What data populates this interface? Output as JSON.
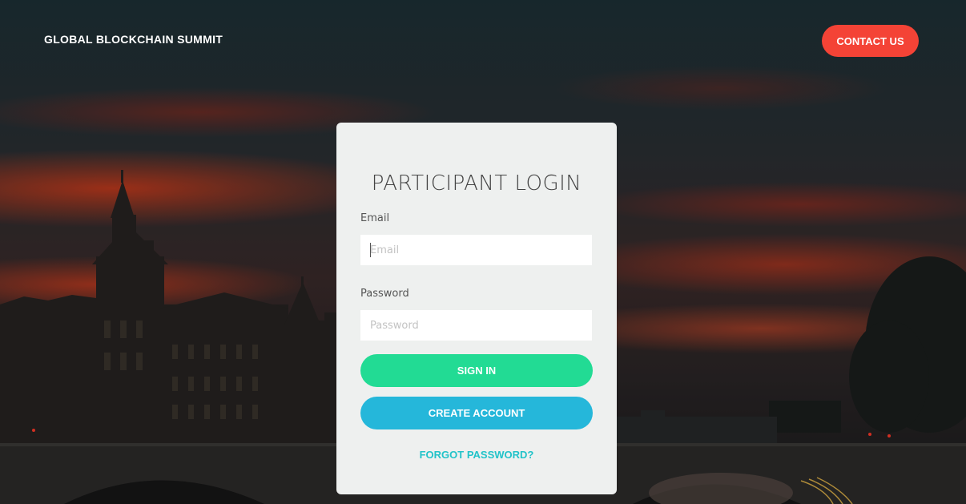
{
  "header": {
    "brand": "GLOBAL BLOCKCHAIN SUMMIT",
    "contact_label": "CONTACT US"
  },
  "login": {
    "title": "PARTICIPANT LOGIN",
    "email_label": "Email",
    "email_placeholder": "Email",
    "email_value": "",
    "password_label": "Password",
    "password_placeholder": "Password",
    "password_value": "",
    "signin_label": "SIGN IN",
    "create_account_label": "CREATE ACCOUNT",
    "forgot_label": "FORGOT PASSWORD?"
  },
  "colors": {
    "contact_button": "#f44336",
    "signin_button": "#22db94",
    "create_account_button": "#25b7da",
    "forgot_link": "#22c3c9",
    "card_background": "#eef0ef"
  }
}
